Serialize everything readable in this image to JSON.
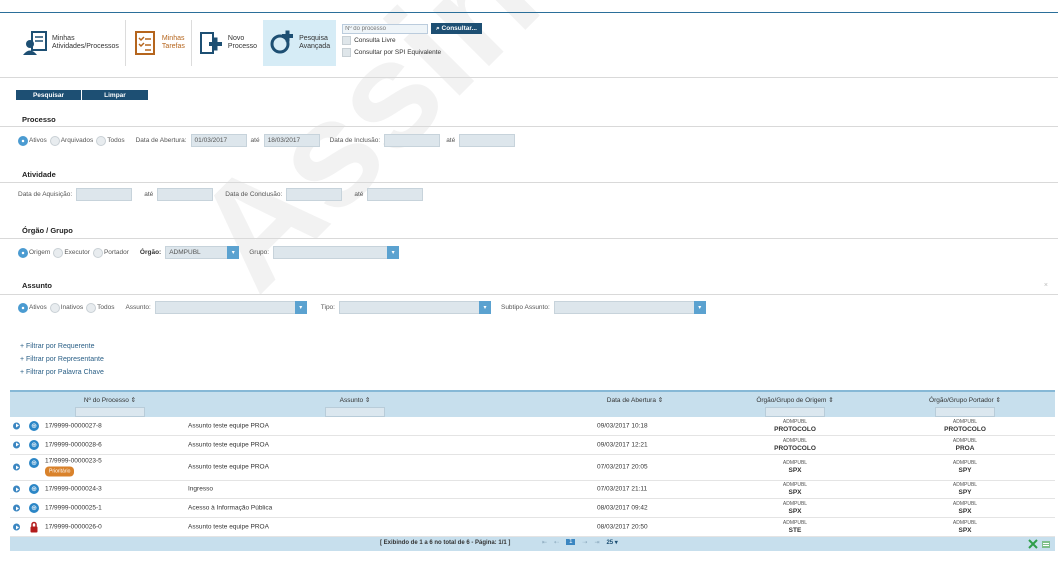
{
  "toolbar": {
    "atividades_label_1": "Minhas",
    "atividades_label_2": "Atividades/Processos",
    "tarefas_label_1": "Minhas",
    "tarefas_label_2": "Tarefas",
    "novo_label_1": "Novo",
    "novo_label_2": "Processo",
    "pesquisa_label_1": "Pesquisa",
    "pesquisa_label_2": "Avançada",
    "process_placeholder": "Nº do processo",
    "consultar_label": "⌕ Consultar...",
    "consulta_livre_label": "Consulta Livre",
    "consultar_spi_label": "Consultar por SPI Equivalente"
  },
  "actions": {
    "pesquisar": "Pesquisar",
    "limpar": "Limpar"
  },
  "processo": {
    "title": "Processo",
    "radio_ativos": "Ativos",
    "radio_arquivados": "Arquivados",
    "radio_todos": "Todos",
    "data_abertura_label": "Data de Abertura:",
    "data_abertura_de": "01/03/2017",
    "ate1": "até",
    "data_abertura_ate": "18/03/2017",
    "data_inclusao_label": "Data de Inclusão:",
    "ate2": "até"
  },
  "atividade": {
    "title": "Atividade",
    "data_aquisicao_label": "Data de Aquisição:",
    "ate1": "até",
    "data_conclusao_label": "Data de Conclusão:",
    "ate2": "até"
  },
  "orgao": {
    "title": "Órgão / Grupo",
    "radio_origem": "Origem",
    "radio_executor": "Executor",
    "radio_portador": "Portador",
    "orgao_label": "Órgão:",
    "orgao_value": "ADMPUBL",
    "grupo_label": "Grupo:"
  },
  "assunto": {
    "title": "Assunto",
    "radio_ativos": "Ativos",
    "radio_inativos": "Inativos",
    "radio_todos": "Todos",
    "assunto_label": "Assunto:",
    "tipo_label": "Tipo:",
    "subtipo_label": "Subtipo Assunto:",
    "close": "×"
  },
  "filters": {
    "requerente": "+ Filtrar por Requerente",
    "representante": "+ Filtrar por Representante",
    "palavra_chave": "+ Filtrar por Palavra Chave"
  },
  "table": {
    "headers": {
      "numero": "Nº do Processo ⇕",
      "assunto": "Assunto ⇕",
      "data": "Data de Abertura ⇕",
      "origem": "Órgão/Grupo de Origem ⇕",
      "portador": "Órgão/Grupo Portador ⇕"
    },
    "rows": [
      {
        "numero": "17/9999-0000027-8",
        "assunto": "Assunto teste equipe PROA",
        "data": "09/03/2017 10:18",
        "origem_org": "ADMPUBL",
        "origem_grupo": "PROTOCOLO",
        "portador_org": "ADMPUBL",
        "portador_grupo": "PROTOCOLO"
      },
      {
        "numero": "17/9999-0000028-6",
        "assunto": "Assunto teste equipe PROA",
        "data": "09/03/2017 12:21",
        "origem_org": "ADMPUBL",
        "origem_grupo": "PROTOCOLO",
        "portador_org": "ADMPUBL",
        "portador_grupo": "PROA"
      },
      {
        "numero": "17/9999-0000023-5",
        "tag": "Prioritário",
        "assunto": "Assunto teste equipe PROA",
        "data": "07/03/2017 20:05",
        "origem_org": "ADMPUBL",
        "origem_grupo": "SPX",
        "portador_org": "ADMPUBL",
        "portador_grupo": "SPY"
      },
      {
        "numero": "17/9999-0000024-3",
        "assunto": "Ingresso",
        "data": "07/03/2017 21:11",
        "origem_org": "ADMPUBL",
        "origem_grupo": "SPX",
        "portador_org": "ADMPUBL",
        "portador_grupo": "SPY"
      },
      {
        "numero": "17/9999-0000025-1",
        "assunto": "Acesso à Informação Pública",
        "data": "08/03/2017 09:42",
        "origem_org": "ADMPUBL",
        "origem_grupo": "SPX",
        "portador_org": "ADMPUBL",
        "portador_grupo": "SPX"
      },
      {
        "numero": "17/9999-0000026-0",
        "assunto": "Assunto teste equipe PROA",
        "data": "08/03/2017 20:50",
        "origem_org": "ADMPUBL",
        "origem_grupo": "STE",
        "portador_org": "ADMPUBL",
        "portador_grupo": "SPX"
      }
    ],
    "footer_info": "[ Exibindo de 1 a 6 no total de 6 - Página: 1/1 ]",
    "pager": {
      "first": "⇤",
      "prev": "⇠",
      "current": "1",
      "next": "⇢",
      "last": "⇥",
      "page_size": "25 ▾"
    }
  },
  "watermark": "Assinado Dig."
}
